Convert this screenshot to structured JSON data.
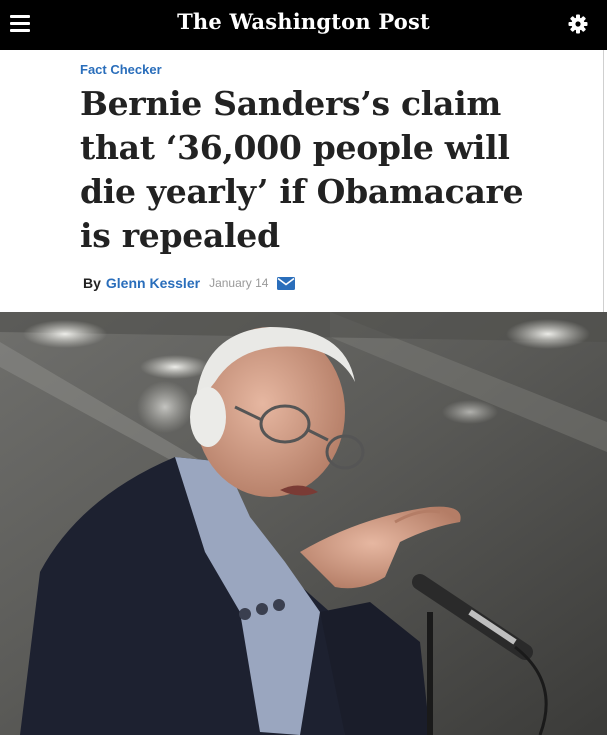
{
  "header": {
    "logo_text": "The Washington Post",
    "menu_icon": "hamburger-menu-icon",
    "settings_icon": "gear-icon",
    "background": "#000000"
  },
  "article": {
    "section": "Fact Checker",
    "headline": "Bernie Sanders’s claim that ‘36,000 people will die yearly’ if Obamacare is repealed",
    "byline": {
      "prefix": "By",
      "author": "Glenn Kessler",
      "date": "January 14",
      "email_icon": "envelope-icon"
    },
    "accent_color": "#2a6ebb"
  },
  "photo": {
    "subject": "speaker-at-microphone"
  }
}
